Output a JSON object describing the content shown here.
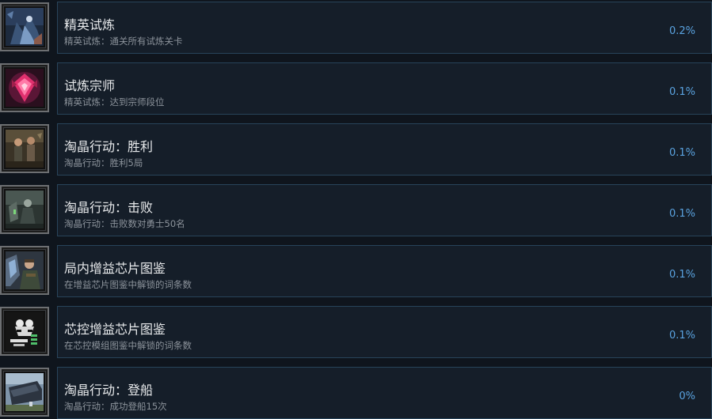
{
  "achievements": [
    {
      "title": "精英试炼",
      "description": "精英试炼：通关所有试炼关卡",
      "percent": "0.2%",
      "icon": "elite-trial-icon"
    },
    {
      "title": "试炼宗师",
      "description": "精英试炼：达到宗师段位",
      "percent": "0.1%",
      "icon": "trial-master-icon"
    },
    {
      "title": "淘晶行动：胜利",
      "description": "淘晶行动：胜利5局",
      "percent": "0.1%",
      "icon": "crystal-op-victory-icon"
    },
    {
      "title": "淘晶行动：击败",
      "description": "淘晶行动：击败数对勇士50名",
      "percent": "0.1%",
      "icon": "crystal-op-defeat-icon"
    },
    {
      "title": "局内增益芯片图鉴",
      "description": "在增益芯片图鉴中解锁的词条数",
      "percent": "0.1%",
      "icon": "buff-chip-codex-icon"
    },
    {
      "title": "芯控增益芯片图鉴",
      "description": "在芯控模组图鉴中解锁的词条数",
      "percent": "0.1%",
      "icon": "chip-control-codex-icon"
    },
    {
      "title": "淘晶行动：登船",
      "description": "淘晶行动：成功登船15次",
      "percent": "0%",
      "icon": "crystal-op-boarding-icon"
    }
  ],
  "colors": {
    "background": "#0f151d",
    "panel": "#151e29",
    "panel_border": "#28445a",
    "title": "#e7e9eb",
    "description": "#8c939b",
    "percent": "#5aa3e0"
  }
}
